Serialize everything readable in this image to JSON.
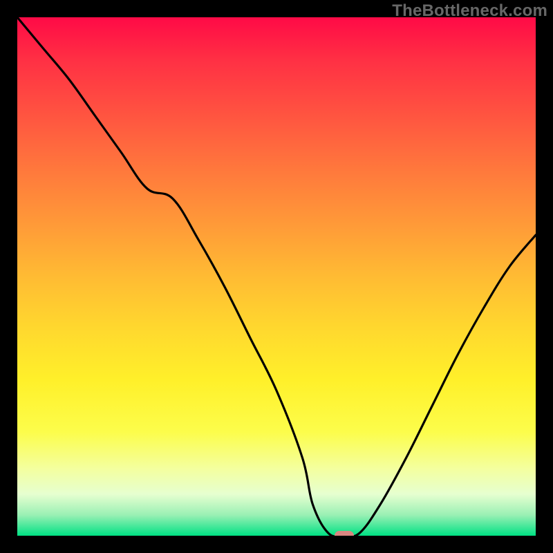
{
  "watermark": "TheBottleneck.com",
  "chart_data": {
    "type": "line",
    "title": "",
    "xlabel": "",
    "ylabel": "",
    "xlim": [
      0,
      100
    ],
    "ylim": [
      0,
      100
    ],
    "x": [
      0,
      5,
      10,
      15,
      20,
      25,
      30,
      35,
      40,
      45,
      50,
      55,
      57,
      60,
      63,
      66,
      70,
      75,
      80,
      85,
      90,
      95,
      100
    ],
    "values": [
      100,
      94,
      88,
      81,
      74,
      67,
      65,
      57,
      48,
      38,
      28,
      15,
      6,
      0.5,
      0,
      0.5,
      6,
      15,
      25,
      35,
      44,
      52,
      58
    ],
    "marker": {
      "x": 63,
      "y": 0
    },
    "background": "red-yellow-green vertical gradient"
  }
}
